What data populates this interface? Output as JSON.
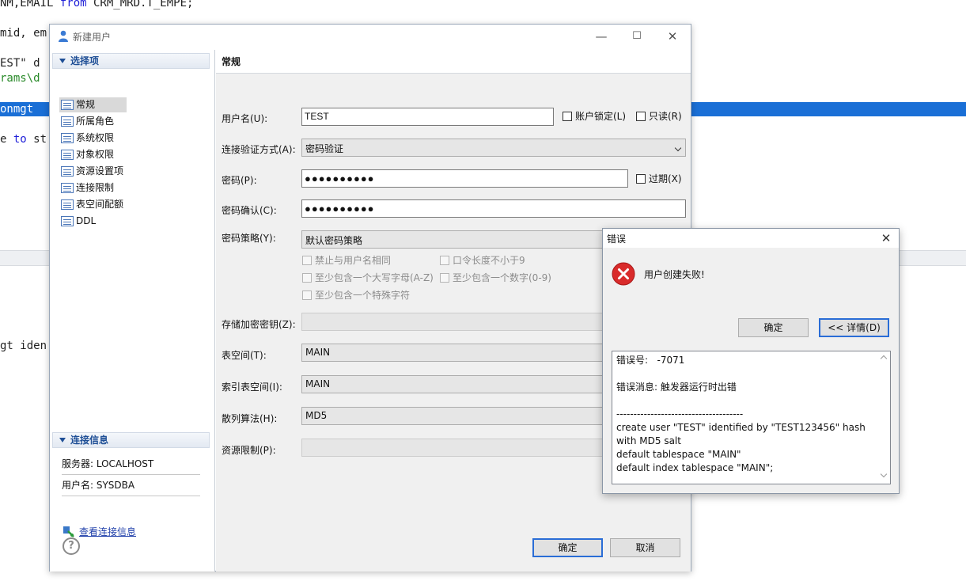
{
  "editor": {
    "lines": [
      {
        "pre": "NM,EMAIL ",
        "kw": "from",
        "post": " CRM_MRD.T_EMPE;"
      },
      {
        "pre": "mid, em",
        "kw": "",
        "post": ""
      },
      {
        "pre": "EST\" d",
        "kw": "",
        "post": ""
      },
      {
        "pre": "rams\\d",
        "kw": "",
        "post": ""
      },
      {
        "pre": "e ",
        "kw": "to",
        "post": " st"
      },
      {
        "pre": "gt iden",
        "kw": "",
        "post": ""
      }
    ],
    "highlighted_line": "onmgt"
  },
  "main_dialog": {
    "title": "新建用户",
    "window_buttons": {
      "minimize": "—",
      "maximize": "☐",
      "close": "✕"
    },
    "options_section": {
      "header": "选择项",
      "items": [
        {
          "label": "常规",
          "selected": true
        },
        {
          "label": "所属角色",
          "selected": false
        },
        {
          "label": "系统权限",
          "selected": false
        },
        {
          "label": "对象权限",
          "selected": false
        },
        {
          "label": "资源设置项",
          "selected": false
        },
        {
          "label": "连接限制",
          "selected": false
        },
        {
          "label": "表空间配额",
          "selected": false
        },
        {
          "label": "DDL",
          "selected": false
        }
      ]
    },
    "connection_section": {
      "header": "连接信息",
      "server": "服务器: LOCALHOST",
      "user": "用户名: SYSDBA",
      "link": "查看连接信息"
    },
    "content": {
      "header": "常规",
      "username_label": "用户名(U):",
      "username_value": "TEST",
      "account_lock_label": "账户锁定(L)",
      "readonly_label": "只读(R)",
      "auth_label": "连接验证方式(A):",
      "auth_value": "密码验证",
      "password_label": "密码(P):",
      "password_value": "●●●●●●●●●●",
      "expired_label": "过期(X)",
      "confirm_label": "密码确认(C):",
      "confirm_value": "●●●●●●●●●●",
      "policy_label": "密码策略(Y):",
      "policy_value": "默认密码策略",
      "policy_options": [
        "禁止与用户名相同",
        "口令长度不小于9",
        "至少包含一个大写字母(A-Z)",
        "至少包含一个数字(0-9)",
        "至少包含一个特殊字符"
      ],
      "encrypt_key_label": "存储加密密钥(Z):",
      "encrypt_key_value": "",
      "tablespace_label": "表空间(T):",
      "tablespace_value": "MAIN",
      "index_tablespace_label": "索引表空间(I):",
      "index_tablespace_value": "MAIN",
      "hash_label": "散列算法(H):",
      "hash_value": "MD5",
      "resource_label": "资源限制(P):",
      "resource_value": ""
    },
    "footer": {
      "help": "?",
      "ok": "确定",
      "cancel": "取消"
    }
  },
  "error_dialog": {
    "title": "错误",
    "close": "✕",
    "message": "用户创建失败!",
    "ok": "确定",
    "details_button": "<< 详情(D)",
    "details": [
      "错误号:   -7071",
      "",
      "错误消息: 触发器运行时出错",
      "",
      "-------------------------------------",
      "create user \"TEST\" identified by \"TEST123456\" hash with MD5 salt",
      "default tablespace \"MAIN\"",
      "default index tablespace \"MAIN\";"
    ]
  }
}
